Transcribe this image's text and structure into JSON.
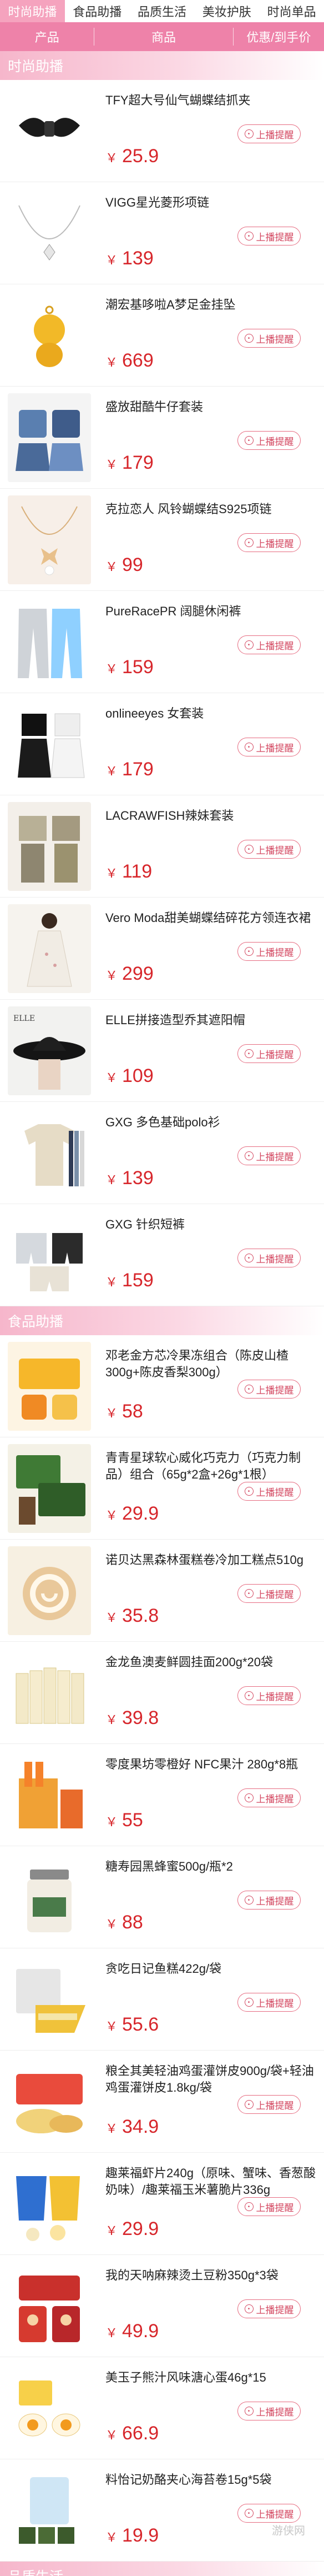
{
  "tabs": [
    "时尚助播",
    "食品助播",
    "品质生活",
    "美妆护肤",
    "时尚单品"
  ],
  "columns": {
    "product": "产品",
    "name": "商品",
    "price": "优惠/到手价"
  },
  "notify_label": "上播提醒",
  "currency": "￥",
  "sections": [
    {
      "title": "时尚助播",
      "items": [
        {
          "name": "TFY超大号仙气蝴蝶结抓夹",
          "price": "25.9",
          "icon": "hair-claw"
        },
        {
          "name": "VIGG星光菱形项链",
          "price": "139",
          "icon": "necklace"
        },
        {
          "name": "潮宏基哆啦A梦足金挂坠",
          "price": "669",
          "icon": "gold-pendant"
        },
        {
          "name": "盛放甜酷牛仔套装",
          "price": "179",
          "icon": "denim-set"
        },
        {
          "name": "克拉恋人 风铃蝴蝶结S925项链",
          "price": "99",
          "icon": "bow-necklace"
        },
        {
          "name": "PureRacePR 阔腿休闲裤",
          "price": "159",
          "icon": "pants"
        },
        {
          "name": "onlineeyes 女套装",
          "price": "179",
          "icon": "outfit"
        },
        {
          "name": "LACRAWFISH辣妹套装",
          "price": "119",
          "icon": "outfit2"
        },
        {
          "name": "Vero Moda甜美蝴蝶结碎花方领连衣裙",
          "price": "299",
          "icon": "dress"
        },
        {
          "name": "ELLE拼接造型乔其遮阳帽",
          "price": "109",
          "icon": "hat"
        },
        {
          "name": "GXG 多色基础polo衫",
          "price": "139",
          "icon": "polo"
        },
        {
          "name": "GXG 针织短裤",
          "price": "159",
          "icon": "shorts"
        }
      ]
    },
    {
      "title": "食品助播",
      "items": [
        {
          "name": "邓老金方芯冷果冻组合（陈皮山楂300g+陈皮香梨300g）",
          "price": "58",
          "icon": "jelly"
        },
        {
          "name": "青青星球软心威化巧克力（巧克力制品）组合（65g*2盒+26g*1根）",
          "price": "29.9",
          "icon": "chocolate"
        },
        {
          "name": "诺贝达黑森林蛋糕卷冷加工糕点510g",
          "price": "35.8",
          "icon": "cake-roll"
        },
        {
          "name": "金龙鱼澳麦鲜圆挂面200g*20袋",
          "price": "39.8",
          "icon": "noodles"
        },
        {
          "name": "零度果坊零橙好 NFC果汁 280g*8瓶",
          "price": "55",
          "icon": "juice"
        },
        {
          "name": "糖寿园黑蜂蜜500g/瓶*2",
          "price": "88",
          "icon": "honey"
        },
        {
          "name": "贪吃日记鱼糕422g/袋",
          "price": "55.6",
          "icon": "fish-cake"
        },
        {
          "name": "粮全其美轻油鸡蛋灌饼皮900g/袋+轻油鸡蛋灌饼皮1.8kg/袋",
          "price": "34.9",
          "icon": "pancake"
        },
        {
          "name": "趣莱福虾片240g（原味、蟹味、香葱酸奶味）/趣莱福玉米薯脆片336g",
          "price": "29.9",
          "icon": "chips"
        },
        {
          "name": "我的天呐麻辣烫土豆粉350g*3袋",
          "price": "49.9",
          "icon": "spicy-noodles"
        },
        {
          "name": "美玉子熊汁风味溏心蛋46g*15",
          "price": "66.9",
          "icon": "eggs"
        },
        {
          "name": "料怡记奶酪夹心海苔卷15g*5袋",
          "price": "19.9",
          "icon": "seaweed"
        }
      ]
    },
    {
      "title": "品质生活"
    }
  ],
  "watermark": "游侠网"
}
